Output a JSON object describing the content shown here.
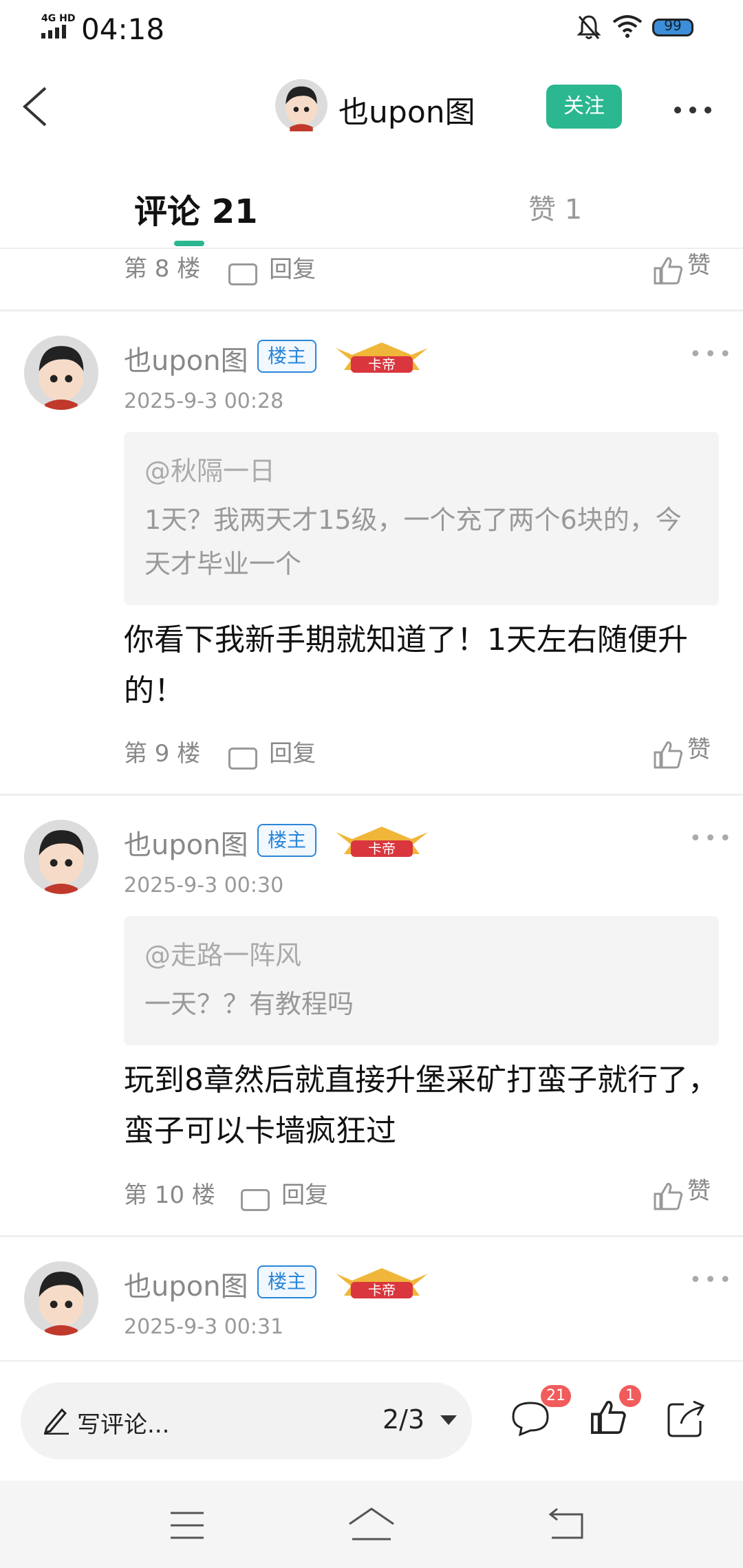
{
  "status_bar": {
    "network": "4G HD",
    "time": "04:18",
    "battery": "99"
  },
  "header": {
    "username": "也upon图",
    "follow_label": "关注"
  },
  "tabs": {
    "comments_label": "评论 21",
    "likes_label": "赞 1"
  },
  "comments": [
    {
      "floor": "第 8 楼",
      "reply_label": "回复",
      "like_label": "赞"
    },
    {
      "username": "也upon图",
      "owner_badge": "楼主",
      "rank_badge": "卡帝",
      "timestamp": "2025-9-3 00:28",
      "quote_user": "@秋隔一日",
      "quote_text": "1天？我两天才15级，一个充了两个6块的，今天才毕业一个",
      "text": "你看下我新手期就知道了！1天左右随便升的！",
      "floor": "第 9 楼",
      "reply_label": "回复",
      "like_label": "赞"
    },
    {
      "username": "也upon图",
      "owner_badge": "楼主",
      "rank_badge": "卡帝",
      "timestamp": "2025-9-3 00:30",
      "quote_user": "@走路一阵风",
      "quote_text": "一天？？有教程吗",
      "text": "玩到8章然后就直接升堡采矿打蛮子就行了，蛮子可以卡墙疯狂过",
      "floor": "第 10 楼",
      "reply_label": "回复",
      "like_label": "赞"
    },
    {
      "username": "也upon图",
      "owner_badge": "楼主",
      "rank_badge": "卡帝",
      "timestamp": "2025-9-3 00:31"
    }
  ],
  "bottom_bar": {
    "write_placeholder": "写评论...",
    "page_indicator": "2/3",
    "comment_count": "21",
    "like_count": "1"
  },
  "colors": {
    "accent": "#2bb790",
    "owner_badge": "#2a86d8",
    "notif_badge": "#f25b5b"
  },
  "icons": [
    "back-icon",
    "more-icon",
    "reply-icon",
    "thumb-up-icon",
    "pencil-icon",
    "comment-icon",
    "share-icon",
    "menu-icon",
    "home-icon",
    "return-icon",
    "bell-off-icon",
    "wifi-icon"
  ]
}
